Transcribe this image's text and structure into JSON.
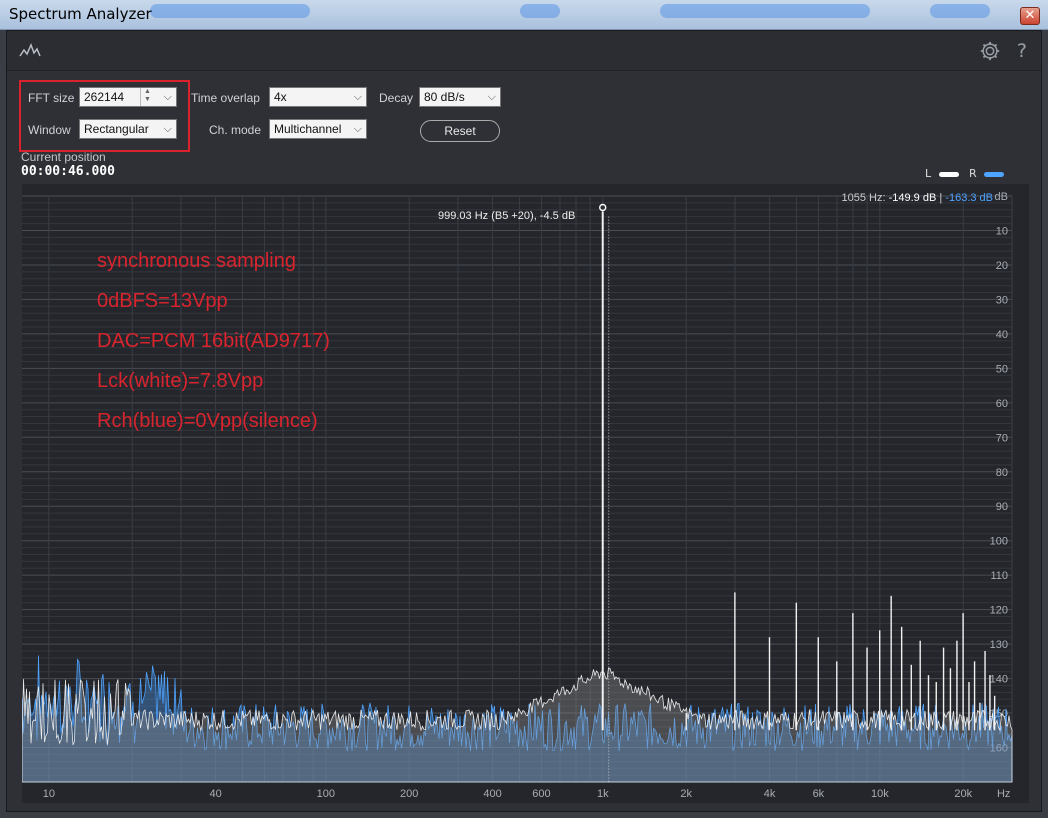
{
  "window": {
    "title": "Spectrum Analyzer",
    "close_glyph": "✕"
  },
  "controls": {
    "fft_size_label": "FFT size",
    "fft_size_value": "262144",
    "window_label": "Window",
    "window_value": "Rectangular",
    "time_overlap_label": "Time overlap",
    "time_overlap_value": "4x",
    "decay_label": "Decay",
    "decay_value": "80 dB/s",
    "ch_mode_label": "Ch. mode",
    "ch_mode_value": "Multichannel",
    "reset_label": "Reset"
  },
  "position": {
    "label": "Current position",
    "value": "00:00:46.000"
  },
  "legend": {
    "l_label": "L",
    "r_label": "R",
    "l_color": "#ffffff",
    "r_color": "#4ea3ff"
  },
  "readout": {
    "freq": "1055 Hz:",
    "l_db": "-149.9 dB",
    "sep": "|",
    "r_db": "-163.3 dB"
  },
  "peak": {
    "label": "999.03 Hz (B5 +20), -4.5 dB"
  },
  "annotations": [
    "synchronous sampling",
    "0dBFS=13Vpp",
    "DAC=PCM 16bit(AD9717)",
    "Lck(white)=7.8Vpp",
    "Rch(blue)=0Vpp(silence)"
  ],
  "icons": {
    "logo": "waveform-logo-icon",
    "settings": "gear-icon",
    "help": "help-icon"
  },
  "chart_data": {
    "type": "line",
    "xscale": "log",
    "xlim": [
      8,
      30000
    ],
    "ylim": [
      0,
      170
    ],
    "yunit": "dB",
    "y_ticks": [
      "dB",
      "10",
      "20",
      "30",
      "40",
      "50",
      "60",
      "70",
      "80",
      "90",
      "100",
      "110",
      "120",
      "130",
      "140",
      "150",
      "160"
    ],
    "x_ticks": [
      {
        "v": 10,
        "t": "10"
      },
      {
        "v": 40,
        "t": "40"
      },
      {
        "v": 100,
        "t": "100"
      },
      {
        "v": 200,
        "t": "200"
      },
      {
        "v": 400,
        "t": "400"
      },
      {
        "v": 600,
        "t": "600"
      },
      {
        "v": 1000,
        "t": "1k"
      },
      {
        "v": 2000,
        "t": "2k"
      },
      {
        "v": 4000,
        "t": "4k"
      },
      {
        "v": 6000,
        "t": "6k"
      },
      {
        "v": 10000,
        "t": "10k"
      },
      {
        "v": 20000,
        "t": "20k"
      },
      {
        "v": 28000,
        "t": "Hz"
      }
    ],
    "series": [
      {
        "name": "L",
        "color": "#ffffff",
        "peaks": [
          [
            999,
            4.5
          ],
          [
            2000,
            150
          ],
          [
            2997,
            115
          ],
          [
            3996,
            128
          ],
          [
            4995,
            118
          ],
          [
            5994,
            128
          ],
          [
            6993,
            135
          ],
          [
            7992,
            121
          ],
          [
            8991,
            131
          ],
          [
            9990,
            126
          ],
          [
            10989,
            116
          ],
          [
            11988,
            125
          ],
          [
            12987,
            136
          ],
          [
            13986,
            129
          ],
          [
            14985,
            139
          ],
          [
            15984,
            141
          ],
          [
            16983,
            131
          ],
          [
            17982,
            137
          ],
          [
            18981,
            129
          ],
          [
            19980,
            121
          ],
          [
            20979,
            141
          ],
          [
            21978,
            135
          ],
          [
            22977,
            147
          ],
          [
            23976,
            132
          ],
          [
            24975,
            139
          ],
          [
            25974,
            145
          ]
        ],
        "noise_floor": 155
      },
      {
        "name": "R",
        "color": "#4ea3ff",
        "noise_floor": 161
      }
    ]
  }
}
